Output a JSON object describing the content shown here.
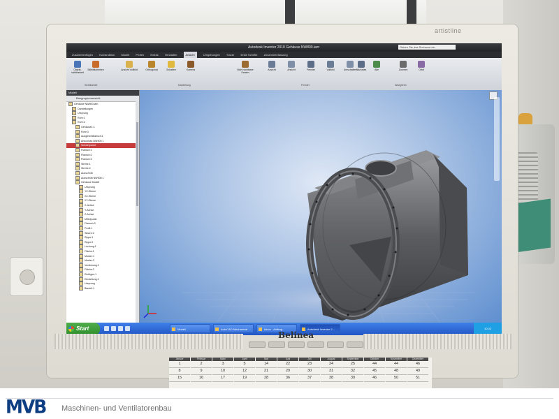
{
  "monitor": {
    "brand_top": "artistline",
    "brand_bottom": "Belinea"
  },
  "app": {
    "title": "Autodesk Inventor 2010   Gehäuse NW800.iam",
    "search_placeholder": "Geben Sie das Suchwort ein",
    "tabs": [
      "Zusammenfügen",
      "Konstruktion",
      "Modell",
      "Prüfen",
      "Extras",
      "Verwalten",
      "Ansicht",
      "Umgebungen",
      "Tracer",
      "Erste Schritte",
      "Zusammenfassung"
    ],
    "active_tab": "Ansicht",
    "ribbon_buttons": [
      "Objekt-sichtbarkeit",
      "Stilbibliotheken",
      "Ansicht Vollbild",
      "Orthogonal",
      "Schatten",
      "Kamera",
      "Nicht sichtbare Kanten",
      "Ansicht",
      "Ansicht",
      "Fenster",
      "Vollbild",
      "Umschalten",
      "Nächstes",
      "Alle",
      "Zoomen",
      "Orbit"
    ],
    "ribbon_groups": [
      "Sichtbarkeit",
      "Darstellung",
      "Fenster",
      "Navigieren"
    ]
  },
  "browser": {
    "header": "Modell",
    "toolbar_label": "Baugruppenansicht",
    "tree_items": [
      "Gehäuse NW800.iam",
      "Darstellungen",
      "Ursprung",
      "Rohr:1",
      "Rohr:2",
      "Gehäuse1:1",
      "Rohr:3",
      "Ausgleichsflansch:1",
      "Anschluss NW400:1",
      "Schwerpunkt",
      "Flansch:1",
      "Flansch:2",
      "Flansch:3",
      "Strebe:1",
      "Strebe:2",
      "Ausschnitt",
      "Ausschnitt NW500:1",
      "Gehäuse Modell",
      "Ursprung",
      "YZ-Ebene",
      "XZ-Ebene",
      "XY-Ebene",
      "X-Achse",
      "Y-Achse",
      "Z-Achse",
      "Mittelpunkt",
      "Flansch:3",
      "Profil:1",
      "Skizze:2",
      "Rippe:1",
      "Rippe:2",
      "Lochung:1",
      "Fläche:1",
      "Muster:1",
      "Muster:2",
      "Verdickung:1",
      "Fläche:2",
      "Einfügen:1",
      "Einstellung:1",
      "Ursprung",
      "Bauteil:1"
    ],
    "highlighted_index": 9
  },
  "taskbar": {
    "start_label": "Start",
    "items": [
      "Modell",
      "AutoCAD Mechanical ...",
      "Inbox - Auftrag...",
      "Autodesk Inventor 2..."
    ],
    "active_index": 3,
    "clock": "10:02"
  },
  "calendar": {
    "months": [
      "Januar",
      "Februar",
      "März",
      "April",
      "Mai",
      "Juni",
      "Juli",
      "August",
      "September",
      "Oktober",
      "November",
      "Dezember"
    ],
    "days": [
      [
        "1",
        "8",
        "15"
      ],
      [
        "2",
        "9",
        "16"
      ],
      [
        "3",
        "10",
        "17"
      ],
      [
        "5",
        "12",
        "19"
      ],
      [
        "14",
        "21",
        "28"
      ],
      [
        "22",
        "29",
        "36"
      ],
      [
        "23",
        "30",
        "37"
      ],
      [
        "24",
        "31",
        "38"
      ],
      [
        "25",
        "32",
        "39"
      ],
      [
        "44",
        "45",
        "46"
      ],
      [
        "44",
        "48",
        "50"
      ],
      [
        "46",
        "49",
        "51"
      ]
    ]
  },
  "footer": {
    "logo": "MVB",
    "tagline": "Maschinen- und Ventilatorenbau"
  },
  "colors": {
    "logo_blue": "#0e3e82",
    "viewport_blue": "#5f8fd0",
    "taskbar_blue": "#2256c6",
    "start_green": "#2f8d2d"
  }
}
